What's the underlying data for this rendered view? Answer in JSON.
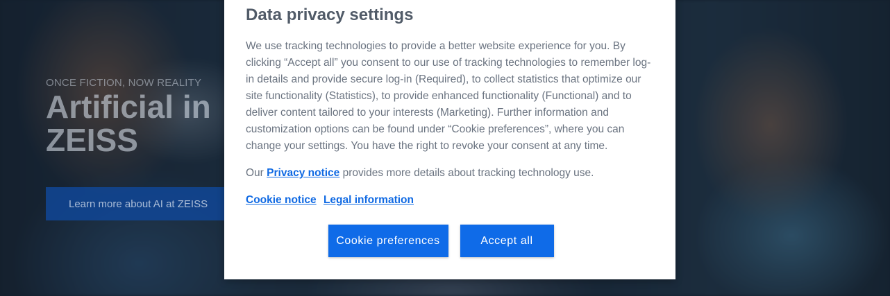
{
  "hero": {
    "eyebrow": "ONCE FICTION, NOW REALITY",
    "title": "Artificial in ZEISS",
    "cta_label": "Learn more about AI at ZEISS"
  },
  "modal": {
    "title": "Data privacy settings",
    "body": "We use tracking technologies to provide a better website experience for you. By clicking “Accept all” you consent to our use of tracking technologies to remember log-in details and provide secure log-in (Required), to collect statistics that optimize our site functionality (Statistics), to provide enhanced functionality (Functional) and to deliver content tailored to your interests (Marketing). Further information and customization options can be found under “Cookie preferences”, where you can change your settings. You have the right to revoke your consent at any time.",
    "privacy_prefix": "Our ",
    "privacy_link": "Privacy notice",
    "privacy_suffix": " provides more details about tracking technology use.",
    "cookie_notice_link": "Cookie notice",
    "legal_link": "Legal information",
    "preferences_button": "Cookie preferences",
    "accept_button": "Accept all"
  },
  "colors": {
    "accent": "#0f6be8",
    "link": "#0f69e3",
    "title_text": "#515b68",
    "body_text": "#6a7380"
  }
}
